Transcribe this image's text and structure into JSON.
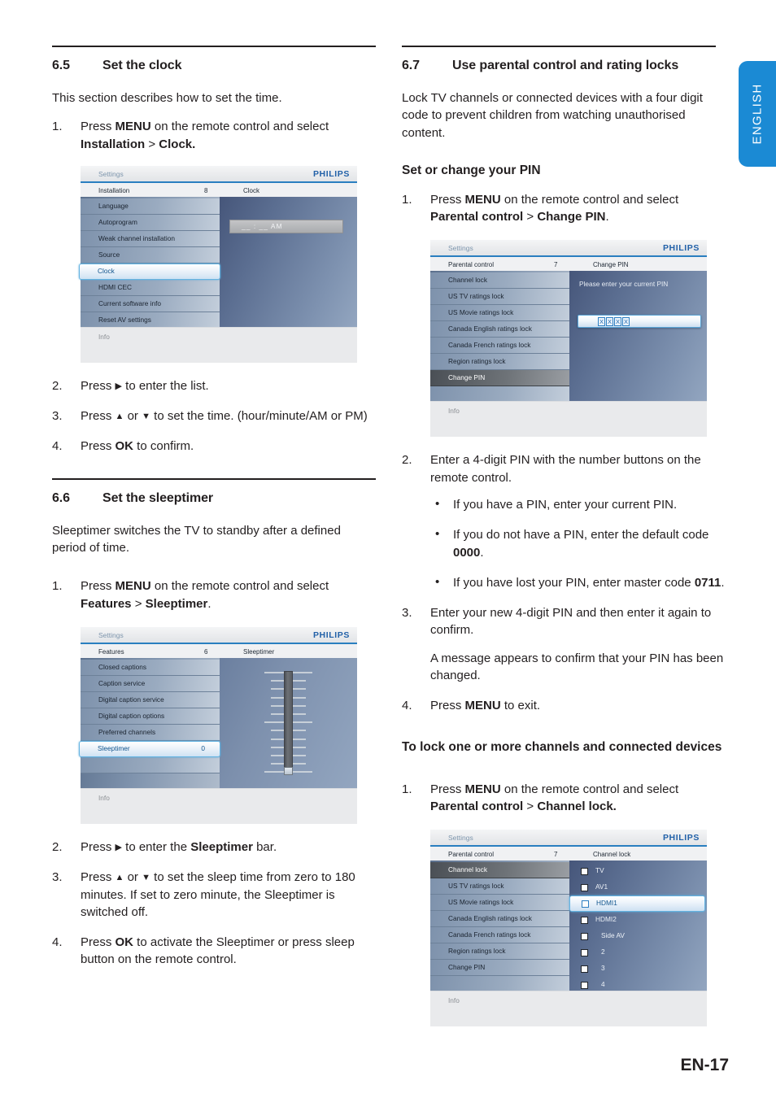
{
  "page": {
    "footer": "EN-17",
    "language_tab": "ENGLISH"
  },
  "left_column": {
    "section_65": {
      "number": "6.5",
      "title": "Set the clock",
      "intro": "This section describes how to set the time.",
      "steps": [
        {
          "n": "1.",
          "parts": [
            {
              "t": "Press ",
              "b": false
            },
            {
              "t": "MENU",
              "b": true
            },
            {
              "t": " on the remote control and select ",
              "b": false
            },
            {
              "t": "Installation",
              "b": true
            },
            {
              "t": " > ",
              "b": false
            },
            {
              "t": "Clock.",
              "b": true
            }
          ]
        },
        {
          "n": "2.",
          "parts": [
            {
              "t": "Press ",
              "b": false
            },
            {
              "t": "▶",
              "b": false
            },
            {
              "t": " to enter the list.",
              "b": false
            }
          ]
        },
        {
          "n": "3.",
          "parts": [
            {
              "t": "Press ",
              "b": false
            },
            {
              "t": "▲",
              "b": false
            },
            {
              "t": " or ",
              "b": false
            },
            {
              "t": "▼",
              "b": false
            },
            {
              "t": " to set the time. (hour/minute/AM or PM)",
              "b": false
            }
          ]
        },
        {
          "n": "4.",
          "parts": [
            {
              "t": "Press ",
              "b": false
            },
            {
              "t": "OK",
              "b": true
            },
            {
              "t": " to confirm.",
              "b": false
            }
          ]
        }
      ]
    },
    "section_66": {
      "number": "6.6",
      "title": "Set the sleeptimer",
      "intro": "Sleeptimer switches the TV to standby after a defined period of time.",
      "steps": [
        {
          "n": "1.",
          "parts": [
            {
              "t": "Press ",
              "b": false
            },
            {
              "t": "MENU",
              "b": true
            },
            {
              "t": " on the remote control and select ",
              "b": false
            },
            {
              "t": "Features",
              "b": true
            },
            {
              "t": " > ",
              "b": false
            },
            {
              "t": "Sleeptimer",
              "b": true
            },
            {
              "t": ".",
              "b": false
            }
          ]
        },
        {
          "n": "2.",
          "parts": [
            {
              "t": "Press ",
              "b": false
            },
            {
              "t": "▶",
              "b": false
            },
            {
              "t": " to enter the ",
              "b": false
            },
            {
              "t": "Sleeptimer",
              "b": true
            },
            {
              "t": " bar.",
              "b": false
            }
          ]
        },
        {
          "n": "3.",
          "parts": [
            {
              "t": "Press ",
              "b": false
            },
            {
              "t": "▲",
              "b": false
            },
            {
              "t": " or ",
              "b": false
            },
            {
              "t": "▼",
              "b": false
            },
            {
              "t": " to set the sleep time from zero to 180 minutes. If set to zero minute, the Sleeptimer is switched off.",
              "b": false
            }
          ]
        },
        {
          "n": "4.",
          "parts": [
            {
              "t": "Press ",
              "b": false
            },
            {
              "t": "OK",
              "b": true
            },
            {
              "t": " to activate the Sleeptimer or press sleep button on the remote control.",
              "b": false
            }
          ]
        }
      ]
    }
  },
  "right_column": {
    "section_67": {
      "number": "6.7",
      "title": "Use parental control and rating locks",
      "intro": "Lock TV channels or connected devices with a four digit code to prevent children from watching unauthorised content.",
      "sub_pin": "Set or change your PIN",
      "pin_steps": [
        {
          "n": "1.",
          "parts": [
            {
              "t": "Press ",
              "b": false
            },
            {
              "t": "MENU",
              "b": true
            },
            {
              "t": " on the remote control and select ",
              "b": false
            },
            {
              "t": "Parental control",
              "b": true
            },
            {
              "t": " > ",
              "b": false
            },
            {
              "t": "Change PIN",
              "b": true
            },
            {
              "t": ".",
              "b": false
            }
          ]
        },
        {
          "n": "2.",
          "parts": [
            {
              "t": "Enter a 4-digit PIN with the number buttons on the remote control.",
              "b": false
            }
          ]
        },
        {
          "n": "3.",
          "parts": [
            {
              "t": "Enter your new 4-digit PIN and then enter it again to confirm.",
              "b": false
            }
          ]
        },
        {
          "n": "4.",
          "parts": [
            {
              "t": "Press ",
              "b": false
            },
            {
              "t": "MENU",
              "b": true
            },
            {
              "t": " to exit.",
              "b": false
            }
          ]
        }
      ],
      "pin_bullets": [
        [
          {
            "t": "If you have a PIN, enter your current PIN.",
            "b": false
          }
        ],
        [
          {
            "t": "If you do not have a PIN, enter the default code ",
            "b": false
          },
          {
            "t": "0000",
            "b": true
          },
          {
            "t": ".",
            "b": false
          }
        ],
        [
          {
            "t": "If you have lost your PIN, enter master code ",
            "b": false
          },
          {
            "t": "0711",
            "b": true
          },
          {
            "t": ".",
            "b": false
          }
        ]
      ],
      "step3_note": "A message appears to confirm that your PIN has been changed.",
      "sub_lock": "To lock one or more channels and connected devices",
      "lock_steps": [
        {
          "n": "1.",
          "parts": [
            {
              "t": "Press ",
              "b": false
            },
            {
              "t": "MENU",
              "b": true
            },
            {
              "t": " on the remote control and select ",
              "b": false
            },
            {
              "t": "Parental control",
              "b": true
            },
            {
              "t": " > ",
              "b": false
            },
            {
              "t": "Channel lock.",
              "b": true
            }
          ]
        }
      ]
    }
  },
  "osd_clock": {
    "settings_label": "Settings",
    "brand": "PHILIPS",
    "breadcrumb_title": "Installation",
    "breadcrumb_count": "8",
    "breadcrumb_right": "Clock",
    "menu_items": [
      {
        "label": "Language",
        "value": "",
        "state": "normal"
      },
      {
        "label": "Autoprogram",
        "value": "",
        "state": "normal"
      },
      {
        "label": "Weak channel installation",
        "value": "",
        "state": "normal"
      },
      {
        "label": "Source",
        "value": "",
        "state": "normal"
      },
      {
        "label": "Clock",
        "value": "",
        "state": "selected-light"
      },
      {
        "label": "HDMI CEC",
        "value": "",
        "state": "normal"
      },
      {
        "label": "Current software info",
        "value": "",
        "state": "normal"
      },
      {
        "label": "Reset AV settings",
        "value": "",
        "state": "normal"
      }
    ],
    "clock_value": "__ : __  AM",
    "info_label": "Info"
  },
  "osd_sleeptimer": {
    "settings_label": "Settings",
    "brand": "PHILIPS",
    "breadcrumb_title": "Features",
    "breadcrumb_count": "6",
    "breadcrumb_right": "Sleeptimer",
    "menu_items": [
      {
        "label": "Closed captions",
        "value": "",
        "state": "normal"
      },
      {
        "label": "Caption service",
        "value": "",
        "state": "normal"
      },
      {
        "label": "Digital caption service",
        "value": "",
        "state": "normal"
      },
      {
        "label": "Digital caption options",
        "value": "",
        "state": "normal"
      },
      {
        "label": "Preferred channels",
        "value": "",
        "state": "normal"
      },
      {
        "label": "Sleeptimer",
        "value": "0",
        "state": "selected-light"
      },
      {
        "label": "",
        "value": "",
        "state": "blank"
      }
    ],
    "slider_value": "0",
    "info_label": "Info"
  },
  "osd_changepin": {
    "settings_label": "Settings",
    "brand": "PHILIPS",
    "breadcrumb_title": "Parental control",
    "breadcrumb_count": "7",
    "breadcrumb_right": "Change PIN",
    "menu_items": [
      {
        "label": "Channel lock",
        "value": "",
        "state": "normal"
      },
      {
        "label": "US TV ratings lock",
        "value": "",
        "state": "normal"
      },
      {
        "label": "US Movie ratings lock",
        "value": "",
        "state": "normal"
      },
      {
        "label": "Canada English ratings lock",
        "value": "",
        "state": "normal"
      },
      {
        "label": "Canada French ratings lock",
        "value": "",
        "state": "normal"
      },
      {
        "label": "Region ratings lock",
        "value": "",
        "state": "normal"
      },
      {
        "label": "Change PIN",
        "value": "",
        "state": "selected-dark"
      },
      {
        "label": "",
        "value": "",
        "state": "blank"
      }
    ],
    "prompt": "Please enter your current PIN",
    "pin_chars": [
      "X",
      "X",
      "X",
      "X"
    ],
    "info_label": "Info"
  },
  "osd_channellock": {
    "settings_label": "Settings",
    "brand": "PHILIPS",
    "breadcrumb_title": "Parental control",
    "breadcrumb_count": "7",
    "breadcrumb_right": "Channel lock",
    "menu_items": [
      {
        "label": "Channel lock",
        "value": "",
        "state": "selected-dark"
      },
      {
        "label": "US TV ratings lock",
        "value": "",
        "state": "normal"
      },
      {
        "label": "US Movie ratings lock",
        "value": "",
        "state": "normal"
      },
      {
        "label": "Canada English ratings lock",
        "value": "",
        "state": "normal"
      },
      {
        "label": "Canada French ratings lock",
        "value": "",
        "state": "normal"
      },
      {
        "label": "Region ratings lock",
        "value": "",
        "state": "normal"
      },
      {
        "label": "Change PIN",
        "value": "",
        "state": "normal"
      },
      {
        "label": "",
        "value": "",
        "state": "blank"
      }
    ],
    "channels": [
      {
        "label": "TV",
        "checked": false,
        "selected": false,
        "indent": false
      },
      {
        "label": "AV1",
        "checked": false,
        "selected": false,
        "indent": false
      },
      {
        "label": "HDMI1",
        "checked": false,
        "selected": true,
        "indent": false
      },
      {
        "label": "HDMI2",
        "checked": false,
        "selected": false,
        "indent": false
      },
      {
        "label": "Side AV",
        "checked": false,
        "selected": false,
        "indent": true
      },
      {
        "label": "2",
        "checked": false,
        "selected": false,
        "indent": true
      },
      {
        "label": "3",
        "checked": false,
        "selected": false,
        "indent": true
      },
      {
        "label": "4",
        "checked": false,
        "selected": false,
        "indent": true
      }
    ],
    "info_label": "Info"
  },
  "colors": {
    "brand_blue": "#2261a8",
    "tab_blue": "#1b8ad4",
    "accent_rule": "#2a7fc0",
    "text": "#231f20"
  }
}
